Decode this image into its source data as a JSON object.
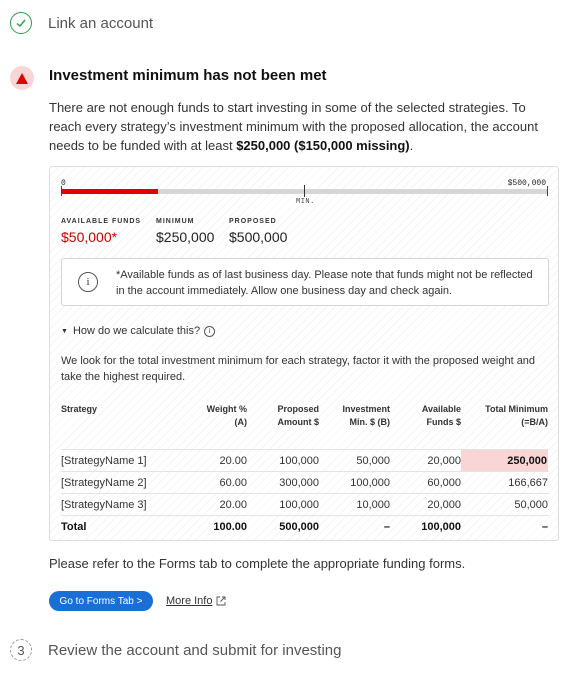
{
  "steps": {
    "link": {
      "label": "Link an account"
    },
    "review": {
      "number": "3",
      "label": "Review the account and submit for investing"
    }
  },
  "warning": {
    "title": "Investment minimum has not been met",
    "text_before": "There are not enough funds to start investing in some of the selected strategies. To reach every strategy’s investment minimum with the proposed allocation, the account needs to be funded with at least ",
    "text_bold": "$250,000 ($150,000 missing)",
    "text_after": "."
  },
  "scale": {
    "min_label": "0",
    "max_label": "$500,000",
    "marker_label": "MIN.",
    "available_fraction": 0.2,
    "minimum_fraction": 0.5
  },
  "stats": {
    "available": {
      "label": "AVAILABLE FUNDS",
      "value": "$50,000*"
    },
    "minimum": {
      "label": "MINIMUM",
      "value": "$250,000"
    },
    "proposed": {
      "label": "PROPOSED",
      "value": "$500,000"
    }
  },
  "note": {
    "icon": "info-icon",
    "text": "*Available funds as of last business day. Please note that funds might not be reflected in the account immediately. Allow one business day and check again."
  },
  "calc": {
    "toggle_label": "How do we calculate this?",
    "description": "We look for the total investment minimum for each strategy, factor it with the proposed weight and take the highest required."
  },
  "table": {
    "headers": [
      [
        "Strategy"
      ],
      [
        "Weight %",
        "(A)"
      ],
      [
        "Proposed",
        "Amount $"
      ],
      [
        "Investment",
        "Min. $ (B)"
      ],
      [
        "Available",
        "Funds $"
      ],
      [
        "Total Minimum",
        "(=B/A)"
      ]
    ],
    "rows": [
      [
        "[StrategyName 1]",
        "20.00",
        "100,000",
        "50,000",
        "20,000",
        "250,000"
      ],
      [
        "[StrategyName 2]",
        "60.00",
        "300,000",
        "100,000",
        "60,000",
        "166,667"
      ],
      [
        "[StrategyName 3]",
        "20.00",
        "100,000",
        "10,000",
        "20,000",
        "50,000"
      ]
    ],
    "total": [
      "Total",
      "100.00",
      "500,000",
      "–",
      "100,000",
      "–"
    ]
  },
  "footer": {
    "forms_text": "Please refer to the Forms tab to complete the appropriate funding forms.",
    "button_label": "Go to Forms Tab  >",
    "more_info_label": "More Info"
  },
  "colors": {
    "accent": "#1a6fd6",
    "alert": "#e00000",
    "success": "#2e9b4c",
    "highlight": "#f9d5d5"
  }
}
